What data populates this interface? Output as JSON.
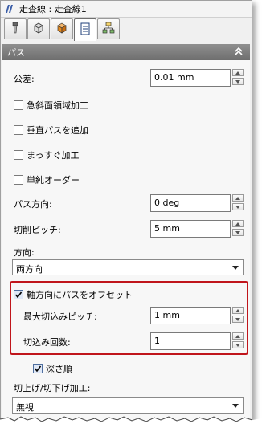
{
  "window": {
    "title": "走査線 : 走査線1"
  },
  "tabs": [
    {
      "icon": "tool-icon"
    },
    {
      "icon": "cube-outline-icon"
    },
    {
      "icon": "cube-orange-icon"
    },
    {
      "icon": "list-sheet-icon"
    },
    {
      "icon": "tree-structure-icon"
    }
  ],
  "section": {
    "title": "パス"
  },
  "fields": {
    "tolerance": {
      "label": "公差:",
      "value": "0.01 mm"
    },
    "steep_area": {
      "label": "急斜面領域加工",
      "checked": false
    },
    "vertical_pass": {
      "label": "垂直パスを追加",
      "checked": false
    },
    "straight": {
      "label": "まっすぐ加工",
      "checked": false
    },
    "simple_order": {
      "label": "単純オーダー",
      "checked": false
    },
    "pass_direction": {
      "label": "パス方向:",
      "value": "0 deg"
    },
    "cutting_pitch": {
      "label": "切削ピッチ:",
      "value": "5 mm"
    },
    "direction": {
      "label": "方向:",
      "selected": "両方向"
    },
    "axial_offset": {
      "label": "軸方向にパスをオフセット",
      "checked": true
    },
    "max_step_down": {
      "label": "最大切込みピッチ:",
      "value": "1 mm"
    },
    "step_count": {
      "label": "切込み回数:",
      "value": "1"
    },
    "depth_order": {
      "label": "深さ順",
      "checked": true
    },
    "ramp": {
      "label": "切上げ/切下げ加工:",
      "selected": "無視"
    }
  },
  "colors": {
    "highlight": "#c0151b",
    "header": "#7a7a7a"
  }
}
